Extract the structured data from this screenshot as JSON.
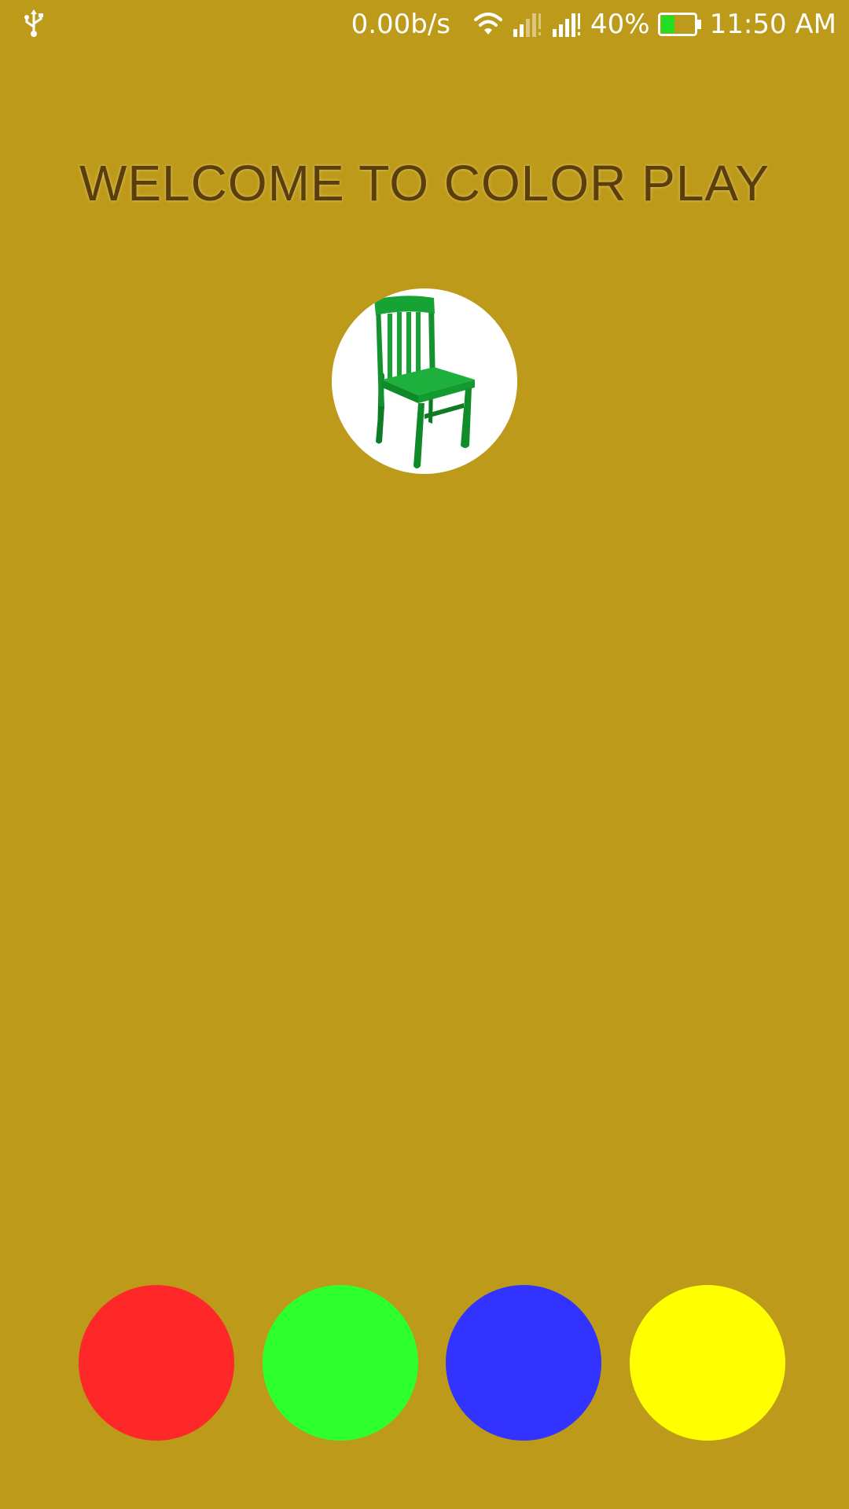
{
  "status_bar": {
    "net_speed": "0.00b/s",
    "battery_percent": "40%",
    "battery_level": 0.4,
    "time": "11:50 AM",
    "icons": [
      "usb-icon",
      "wifi-icon",
      "signal-icon",
      "signal-icon",
      "battery-icon"
    ]
  },
  "title": "WELCOME TO COLOR PLAY",
  "picture": {
    "icon": "green-chair-image"
  },
  "color_buttons": [
    {
      "name": "red",
      "color": "#FF2828"
    },
    {
      "name": "green",
      "color": "#2EFF2E"
    },
    {
      "name": "blue",
      "color": "#3333FF"
    },
    {
      "name": "yellow",
      "color": "#FFFF00"
    }
  ],
  "colors": {
    "background": "#BD9A19",
    "title_text": "#5A3F0C"
  }
}
